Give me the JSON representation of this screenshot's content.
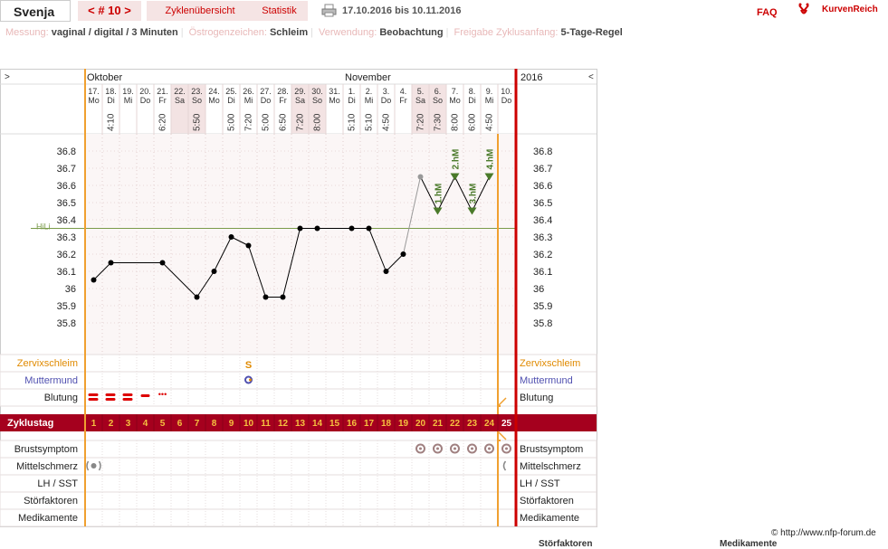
{
  "header": {
    "user_name": "Svenja",
    "cycle_label": "< # 10 >",
    "tab_overview": "Zyklenübersicht",
    "tab_stats": "Statistik",
    "date_range": "17.10.2016 bis 10.11.2016",
    "faq": "FAQ",
    "logo": "KurvenReich"
  },
  "info": {
    "measure_label": "Messung:",
    "measure_value": "vaginal / digital / 3 Minuten",
    "estrogen_label": "Östrogenzeichen:",
    "estrogen_value": "Schleim",
    "usage_label": "Verwendung:",
    "usage_value": "Beobachtung",
    "release_label": "Freigabe Zyklusanfang:",
    "release_value": "5-Tage-Regel"
  },
  "chart": {
    "nav_left": ">",
    "nav_right": "<",
    "month_1": "Oktober",
    "month_2": "November",
    "year": "2016",
    "days": [
      {
        "date": "17.",
        "wd": "Mo",
        "time": ""
      },
      {
        "date": "18.",
        "wd": "Di",
        "time": "4:10"
      },
      {
        "date": "19.",
        "wd": "Mi",
        "time": ""
      },
      {
        "date": "20.",
        "wd": "Do",
        "time": ""
      },
      {
        "date": "21.",
        "wd": "Fr",
        "time": "6:20"
      },
      {
        "date": "22.",
        "wd": "Sa",
        "time": ""
      },
      {
        "date": "23.",
        "wd": "So",
        "time": "5:50"
      },
      {
        "date": "24.",
        "wd": "Mo",
        "time": ""
      },
      {
        "date": "25.",
        "wd": "Di",
        "time": "5:00"
      },
      {
        "date": "26.",
        "wd": "Mi",
        "time": "7:20"
      },
      {
        "date": "27.",
        "wd": "Do",
        "time": "5:00"
      },
      {
        "date": "28.",
        "wd": "Fr",
        "time": "6:50"
      },
      {
        "date": "29.",
        "wd": "Sa",
        "time": "7:20"
      },
      {
        "date": "30.",
        "wd": "So",
        "time": "8:00"
      },
      {
        "date": "31.",
        "wd": "Mo",
        "time": ""
      },
      {
        "date": "1.",
        "wd": "Di",
        "time": "5:10"
      },
      {
        "date": "2.",
        "wd": "Mi",
        "time": "5:10"
      },
      {
        "date": "3.",
        "wd": "Do",
        "time": "4:50"
      },
      {
        "date": "4.",
        "wd": "Fr",
        "time": ""
      },
      {
        "date": "5.",
        "wd": "Sa",
        "time": "7:20"
      },
      {
        "date": "6.",
        "wd": "So",
        "time": "7:30"
      },
      {
        "date": "7.",
        "wd": "Mo",
        "time": "8:00"
      },
      {
        "date": "8.",
        "wd": "Di",
        "time": "6:00"
      },
      {
        "date": "9.",
        "wd": "Mi",
        "time": "4:50"
      },
      {
        "date": "10.",
        "wd": "Do",
        "time": ""
      }
    ],
    "weekend_indices": [
      5,
      6,
      12,
      13,
      19,
      20
    ],
    "temperatures": [
      36.05,
      36.15,
      null,
      null,
      36.15,
      null,
      35.95,
      36.1,
      36.3,
      36.25,
      35.95,
      35.95,
      36.35,
      36.35,
      null,
      36.35,
      36.35,
      36.1,
      36.2,
      36.65,
      36.45,
      36.65,
      36.45,
      36.65,
      null
    ],
    "gray_points": [
      18,
      19
    ],
    "y_ticks": [
      "36.8",
      "36.7",
      "36.6",
      "36.5",
      "36.4",
      "36.3",
      "36.2",
      "36.1",
      "36",
      "35.9",
      "35.8"
    ],
    "hili_label": "HiLi",
    "hili_value": 36.35,
    "high_marks": [
      {
        "day": 20,
        "label": "1.hM"
      },
      {
        "day": 21,
        "label": "2.hM"
      },
      {
        "day": 22,
        "label": "3.hM"
      },
      {
        "day": 23,
        "label": "4.hM"
      }
    ],
    "rows_top": {
      "mucus": "Zervixschleim",
      "cervix": "Muttermund",
      "bleeding": "Blutung"
    },
    "mucus_mark": "S",
    "cycle_day_label": "Zyklustag",
    "cycle_days": [
      "1",
      "2",
      "3",
      "4",
      "5",
      "6",
      "7",
      "8",
      "9",
      "10",
      "11",
      "12",
      "13",
      "14",
      "15",
      "16",
      "17",
      "18",
      "19",
      "20",
      "21",
      "22",
      "23",
      "24",
      "25"
    ],
    "rows_bottom": {
      "breast": "Brustsymptom",
      "midpain": "Mittelschmerz",
      "lh": "LH / SST",
      "disturb": "Störfaktoren",
      "meds": "Medikamente"
    }
  },
  "footer": {
    "copyright": "© http://www.nfp-forum.de",
    "cut_1": "Störfaktoren",
    "cut_2": "Medikamente"
  }
}
